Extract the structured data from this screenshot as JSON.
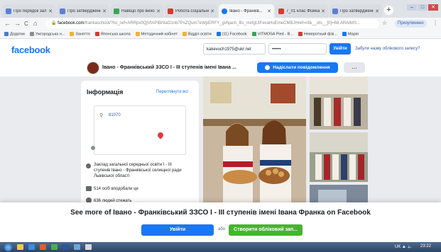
{
  "browser": {
    "tabs": [
      {
        "label": "Про порядок зал...",
        "color": "#5b7fd6",
        "active": false
      },
      {
        "label": "Про затвердження ...",
        "color": "#5b7fd6",
        "active": false
      },
      {
        "label": "Навіщо про вихова...",
        "color": "#3aa655",
        "active": false
      },
      {
        "label": "Робота соціально...",
        "color": "#d33b2f",
        "active": false
      },
      {
        "label": "Івано - Франків...",
        "color": "#1877f2",
        "active": true
      },
      {
        "label": "7_01 клас Фізика ...",
        "color": "#d33b2f",
        "active": false
      },
      {
        "label": "Про затвердженн...",
        "color": "#5b7fd6",
        "active": false
      }
    ],
    "new_tab": "+",
    "nav": {
      "back": "←",
      "forward": "→",
      "reload": "C",
      "home": "⌂"
    },
    "url_domain": "facebook.com",
    "url_path": "/frankaschool/?hc_ref=ARRpv0QjVIAPIBr9aO1nb7PsZQum7eWpERFY_gvhjach_Bs_mxfgUtFevaHuEmeCMBJHref=nf&__xts__[0]=68.ARAIMS...",
    "profile_label": "Призупинено",
    "bookmarks": [
      {
        "label": "Додатки",
        "color": "#4a7bd0"
      },
      {
        "label": "Ужгородська н...",
        "color": "#8a8d91"
      },
      {
        "label": "Заняття",
        "color": "#f2b134"
      },
      {
        "label": "Японська школа",
        "color": "#d33b2f"
      },
      {
        "label": "Методичний кабінет",
        "color": "#f2b134"
      },
      {
        "label": "Відділ освіти",
        "color": "#f2b134"
      },
      {
        "label": "(11) Facebook",
        "color": "#1877f2"
      },
      {
        "label": "VITMOSA Pied - B...",
        "color": "#3aa655"
      },
      {
        "label": "Неверотный фізі...",
        "color": "#d33b2f"
      },
      {
        "label": "Марія",
        "color": "#1877f2"
      }
    ]
  },
  "facebook": {
    "logo": "facebook",
    "email_value": "kakevuch1975@ukr.net",
    "password_value": "••••••",
    "login_label": "Увійти",
    "forgot_label": "Забули назву облікового запису?",
    "page_name": "Івано - Франківський ЗЗСО І - ІІІ ступенів імені Івана ...",
    "message_label": "Надіслати повідомлення",
    "more_label": "...",
    "info": {
      "title": "Інформація",
      "see_all": "Переглянути всі",
      "zip": "81070",
      "school_desc": "Заклад загальної середньої освіти І - ІІІ ступенів Івано - Франківської селищної ради Львівської області",
      "likes": "514 осіб вподобали це",
      "followers": "636 людей стежать"
    },
    "banner": {
      "title": "See more of Івано - Франківський ЗЗСО І - ІІІ ступенів імені Івана Франка on Facebook",
      "login_label": "Увійти",
      "or_label": "або",
      "create_label": "Створити обліковий зап..."
    }
  },
  "taskbar": {
    "tray": "UK  ▲  🔈",
    "clock": "23:22"
  }
}
